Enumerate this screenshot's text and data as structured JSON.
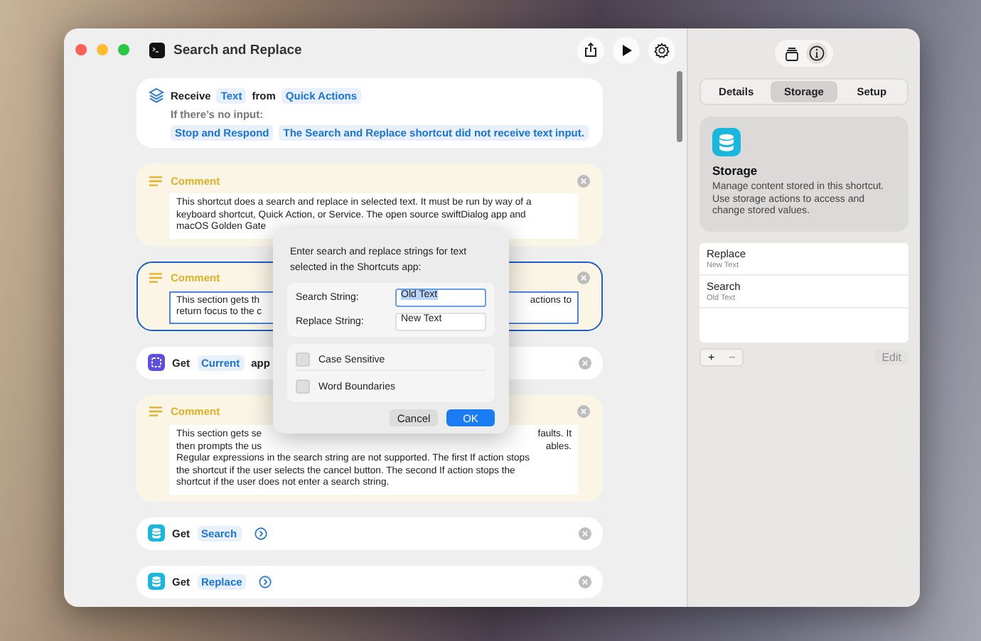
{
  "window": {
    "title": "Search and Replace"
  },
  "actions": [
    {
      "kind": "receive",
      "verb": "Receive",
      "input": "Text",
      "connector": "from",
      "source": "Quick Actions",
      "fallback_label": "If there’s no input:",
      "fallback": [
        "Stop and Respond",
        "The Search and Replace shortcut did not receive text input."
      ]
    },
    {
      "kind": "comment",
      "title": "Comment",
      "selected": false,
      "lines": [
        [
          "This shortcut does a search and replace in selected text. It must be run by way of a"
        ],
        [
          "keyboard shortcut, Quick Action, or Service. The open source swiftDialog app and"
        ],
        [
          "macOS Golden Gate"
        ]
      ]
    },
    {
      "kind": "comment",
      "title": "Comment",
      "selected": true,
      "lines": [
        [
          "This section gets th",
          "actions to"
        ],
        [
          "return focus to the c"
        ]
      ]
    },
    {
      "kind": "get-app",
      "verb": "Get",
      "value": "Current",
      "suffix": "app",
      "expandable": false
    },
    {
      "kind": "comment",
      "title": "Comment",
      "selected": false,
      "lines": [
        [
          "This section gets se",
          "faults. It"
        ],
        [
          "then prompts the us",
          "ables."
        ],
        [
          "Regular expressions in the search string are not supported. The first If action stops"
        ],
        [
          "the shortcut if the user selects the cancel button. The second If action stops the"
        ],
        [
          "shortcut if the user does not enter a search string."
        ]
      ]
    },
    {
      "kind": "get-storage",
      "verb": "Get",
      "value": "Search",
      "expandable": true
    },
    {
      "kind": "get-storage",
      "verb": "Get",
      "value": "Replace",
      "expandable": true
    }
  ],
  "dialog": {
    "message": "Enter search and replace strings for text selected in the Shortcuts app:",
    "fields": [
      {
        "label": "Search String:",
        "value": "Old Text",
        "focused": true
      },
      {
        "label": "Replace String:",
        "value": "New Text",
        "focused": false
      }
    ],
    "options": [
      {
        "label": "Case Sensitive",
        "checked": false
      },
      {
        "label": "Word Boundaries",
        "checked": false
      }
    ],
    "buttons": [
      {
        "label": "Cancel",
        "default": false
      },
      {
        "label": "OK",
        "default": true
      }
    ]
  },
  "sidebar": {
    "tabs": [
      {
        "label": "Details",
        "selected": false
      },
      {
        "label": "Storage",
        "selected": true
      },
      {
        "label": "Setup",
        "selected": false
      }
    ],
    "card": {
      "title": "Storage",
      "description": "Manage content stored in this shortcut. Use storage actions to access and change stored values."
    },
    "items": [
      {
        "name": "Replace",
        "value": "New Text"
      },
      {
        "name": "Search",
        "value": "Old Text"
      }
    ],
    "buttons": [
      {
        "label": "+",
        "disabled": false
      },
      {
        "label": "−",
        "disabled": true
      },
      {
        "label": "Edit",
        "disabled": true
      }
    ]
  }
}
